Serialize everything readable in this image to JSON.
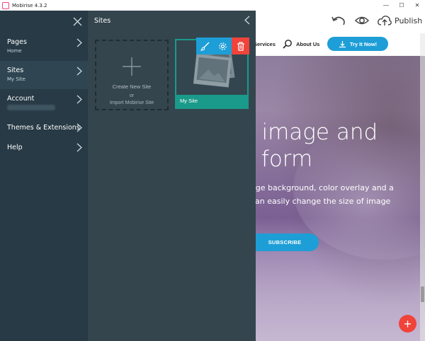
{
  "window": {
    "title": "Mobirise 4.3.2",
    "controls": [
      "—",
      "☐",
      "✕"
    ]
  },
  "toolbar": {
    "publish_label": "Publish"
  },
  "preview": {
    "nav": {
      "services": "Services",
      "about": "About Us",
      "try_button": "Try It Now!"
    },
    "hero_line1": "h image and",
    "hero_line2": "e form",
    "text_line1": "age background, color overlay and a",
    "text_line2": "can easily change the size of image",
    "subscribe": "SUBSCRIBE",
    "fab": "+"
  },
  "menu": {
    "items": [
      {
        "label": "Pages",
        "sub": "Home"
      },
      {
        "label": "Sites",
        "sub": "My Site"
      },
      {
        "label": "Account",
        "sub": ""
      },
      {
        "label": "Themes & Extensions",
        "sub": ""
      },
      {
        "label": "Help",
        "sub": ""
      }
    ]
  },
  "sites_panel": {
    "title": "Sites",
    "create_label": "Create New Site",
    "or_label": "or",
    "import_label": "Import Mobirise Site",
    "site_name": "My Site"
  },
  "colors": {
    "accent": "#1e9ed6",
    "danger": "#f0433a",
    "menu_bg": "#273a45",
    "panel_bg": "#34454e",
    "site_card": "#1a9a8a"
  }
}
